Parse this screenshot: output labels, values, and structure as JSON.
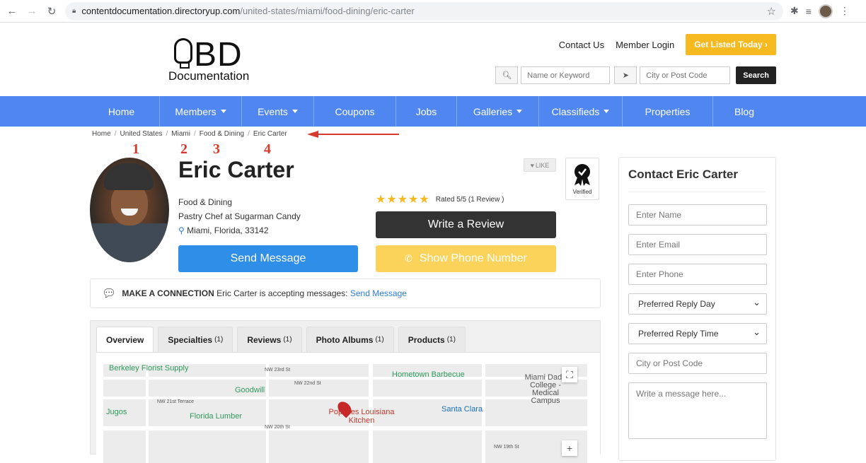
{
  "browser": {
    "url_host": "contentdocumentation.directoryup.com",
    "url_path": "/united-states/miami/food-dining/eric-carter"
  },
  "logo": {
    "top": "BD",
    "bottom": "Documentation"
  },
  "header": {
    "contact_us": "Contact Us",
    "member_login": "Member Login",
    "get_listed": "Get Listed Today",
    "search_keyword_placeholder": "Name or Keyword",
    "search_location_placeholder": "City or Post Code",
    "search_button": "Search"
  },
  "nav": [
    {
      "label": "Home",
      "dropdown": false
    },
    {
      "label": "Members",
      "dropdown": true
    },
    {
      "label": "Events",
      "dropdown": true
    },
    {
      "label": "Coupons",
      "dropdown": false
    },
    {
      "label": "Jobs",
      "dropdown": false
    },
    {
      "label": "Galleries",
      "dropdown": true
    },
    {
      "label": "Classifieds",
      "dropdown": true
    },
    {
      "label": "Properties",
      "dropdown": false
    },
    {
      "label": "Blog",
      "dropdown": false
    }
  ],
  "breadcrumb": [
    "Home",
    "United States",
    "Miami",
    "Food & Dining",
    "Eric Carter"
  ],
  "annotation_numbers": [
    "1",
    "2",
    "3",
    "4"
  ],
  "profile": {
    "name": "Eric Carter",
    "category": "Food & Dining",
    "title": "Pastry Chef at Sugarman Candy",
    "location": "Miami, Florida, 33142",
    "like": "LIKE",
    "verified": "Verified",
    "rating_text": "Rated 5/5 (1 Review )",
    "stars": 5,
    "write_review": "Write a Review",
    "send_message": "Send Message",
    "show_phone": "Show Phone Number"
  },
  "connection": {
    "heading": "MAKE A CONNECTION",
    "text": "Eric Carter is accepting messages:",
    "link": "Send Message"
  },
  "tabs": [
    {
      "label": "Overview",
      "count": ""
    },
    {
      "label": "Specialties",
      "count": "(1)"
    },
    {
      "label": "Reviews",
      "count": "(1)"
    },
    {
      "label": "Photo Albums",
      "count": "(1)"
    },
    {
      "label": "Products",
      "count": "(1)"
    }
  ],
  "map": {
    "places": [
      "Berkeley Florist Supply",
      "Hometown Barbecue",
      "Goodwill",
      "Jugos",
      "Florida Lumber",
      "Popeyes Louisiana Kitchen",
      "Santa Clara",
      "Miami Dade College - Medical Campus"
    ],
    "streets": [
      "NW 23rd St",
      "NW 22nd St",
      "NW 21st Terrace",
      "NW 20th St",
      "NW 19th St"
    ]
  },
  "contact": {
    "heading": "Contact Eric Carter",
    "name_placeholder": "Enter Name",
    "email_placeholder": "Enter Email",
    "phone_placeholder": "Enter Phone",
    "reply_day": "Preferred Reply Day",
    "reply_time": "Preferred Reply Time",
    "city_placeholder": "City or Post Code",
    "message_placeholder": "Write a message here..."
  },
  "colors": {
    "nav_blue": "#4f86f0",
    "accent_yellow": "#f7b920",
    "send_blue": "#2f8fe8",
    "annotation_red": "#d73a2c"
  }
}
